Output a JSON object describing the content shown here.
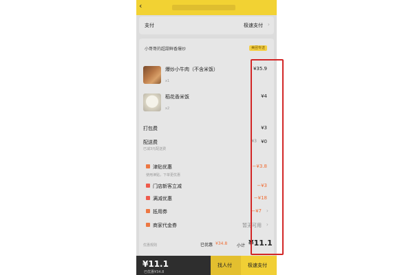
{
  "app": {
    "back_icon": "back-arrow-icon"
  },
  "payment": {
    "label": "支付",
    "method": "极速支付"
  },
  "shop": {
    "name": "小哥哥的超甜鲜香爆炒",
    "tag": "美团专送"
  },
  "items": [
    {
      "name": "爆炒小牛肉（不含米饭）",
      "qty": "x1",
      "price": "¥35.9"
    },
    {
      "name": "稻花香米饭",
      "qty": "x2",
      "price": "¥4"
    }
  ],
  "fees": [
    {
      "label": "打包费",
      "value": "¥3"
    },
    {
      "label": "配送费",
      "sub": "已减3元配送费",
      "old": "¥3",
      "value": "¥0"
    }
  ],
  "discounts": [
    {
      "label": "津贴优惠",
      "sub": "使用津贴，下单更优惠",
      "value": "−¥3.8"
    },
    {
      "label": "门店新客立减",
      "value": "−¥3"
    },
    {
      "label": "满减优惠",
      "value": "−¥18"
    },
    {
      "label": "抵用券",
      "value": "−¥7"
    },
    {
      "label": "商家代金券",
      "value": "暂无可用"
    }
  ],
  "summary": {
    "rules": "优惠规则",
    "saved_label": "已优惠",
    "saved_value": "¥34.8",
    "subtotal_label": "小计",
    "subtotal_value": "¥11.1"
  },
  "bottom": {
    "total": "¥11.1",
    "saved": "已优惠¥34.8",
    "find_pay": "找人付",
    "quick_pay": "极速支付"
  },
  "colors": {
    "accent": "#f2d233",
    "discount": "#f06b32",
    "highlight": "#d22525"
  }
}
